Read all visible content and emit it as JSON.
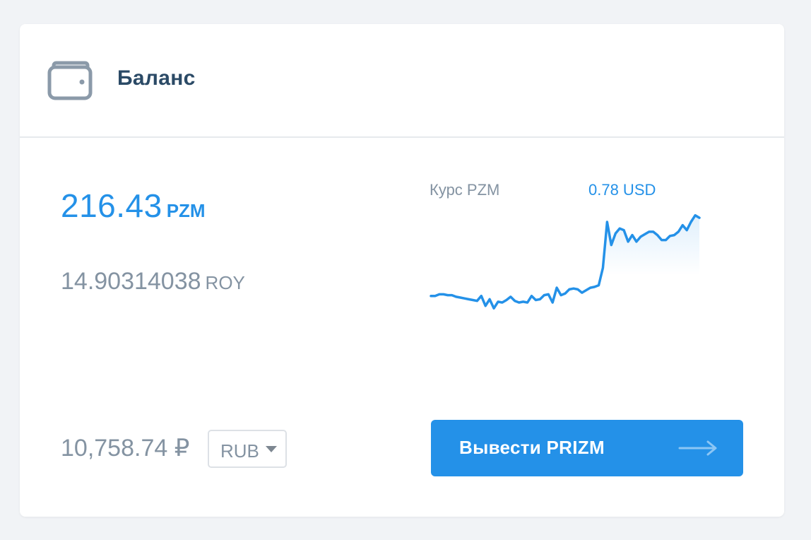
{
  "header": {
    "title": "Баланс",
    "icon": "wallet-icon"
  },
  "balance": {
    "pzm_value": "216.43",
    "pzm_unit": "PZM",
    "roy_value": "14.90314038",
    "roy_unit": "ROY"
  },
  "rate": {
    "label": "Курс PZM",
    "value": "0.78 USD"
  },
  "fiat": {
    "amount": "10,758.74 ₽",
    "currency_selected": "RUB"
  },
  "actions": {
    "withdraw_label": "Вывести PRIZM",
    "withdraw_icon": "arrow-right-icon"
  },
  "colors": {
    "accent": "#2491e8",
    "muted_text": "#8493a2",
    "heading": "#2b4a66",
    "line": "#2491e8"
  },
  "chart_data": {
    "type": "line",
    "series": [
      {
        "values": [
          0.1,
          0.1,
          0.12,
          0.12,
          0.11,
          0.11,
          0.09,
          0.08,
          0.07,
          0.06,
          0.05,
          0.04,
          0.1,
          -0.02,
          0.06,
          -0.05,
          0.03,
          0.02,
          0.05,
          0.09,
          0.04,
          0.02,
          0.03,
          0.02,
          0.1,
          0.05,
          0.06,
          0.11,
          0.12,
          0.02,
          0.2,
          0.11,
          0.13,
          0.18,
          0.19,
          0.18,
          0.14,
          0.17,
          0.2,
          0.21,
          0.23,
          0.44,
          1.0,
          0.72,
          0.86,
          0.92,
          0.9,
          0.76,
          0.84,
          0.76,
          0.82,
          0.85,
          0.88,
          0.88,
          0.84,
          0.78,
          0.78,
          0.83,
          0.84,
          0.88,
          0.96,
          0.9,
          1.0,
          1.08,
          1.05
        ]
      }
    ]
  }
}
